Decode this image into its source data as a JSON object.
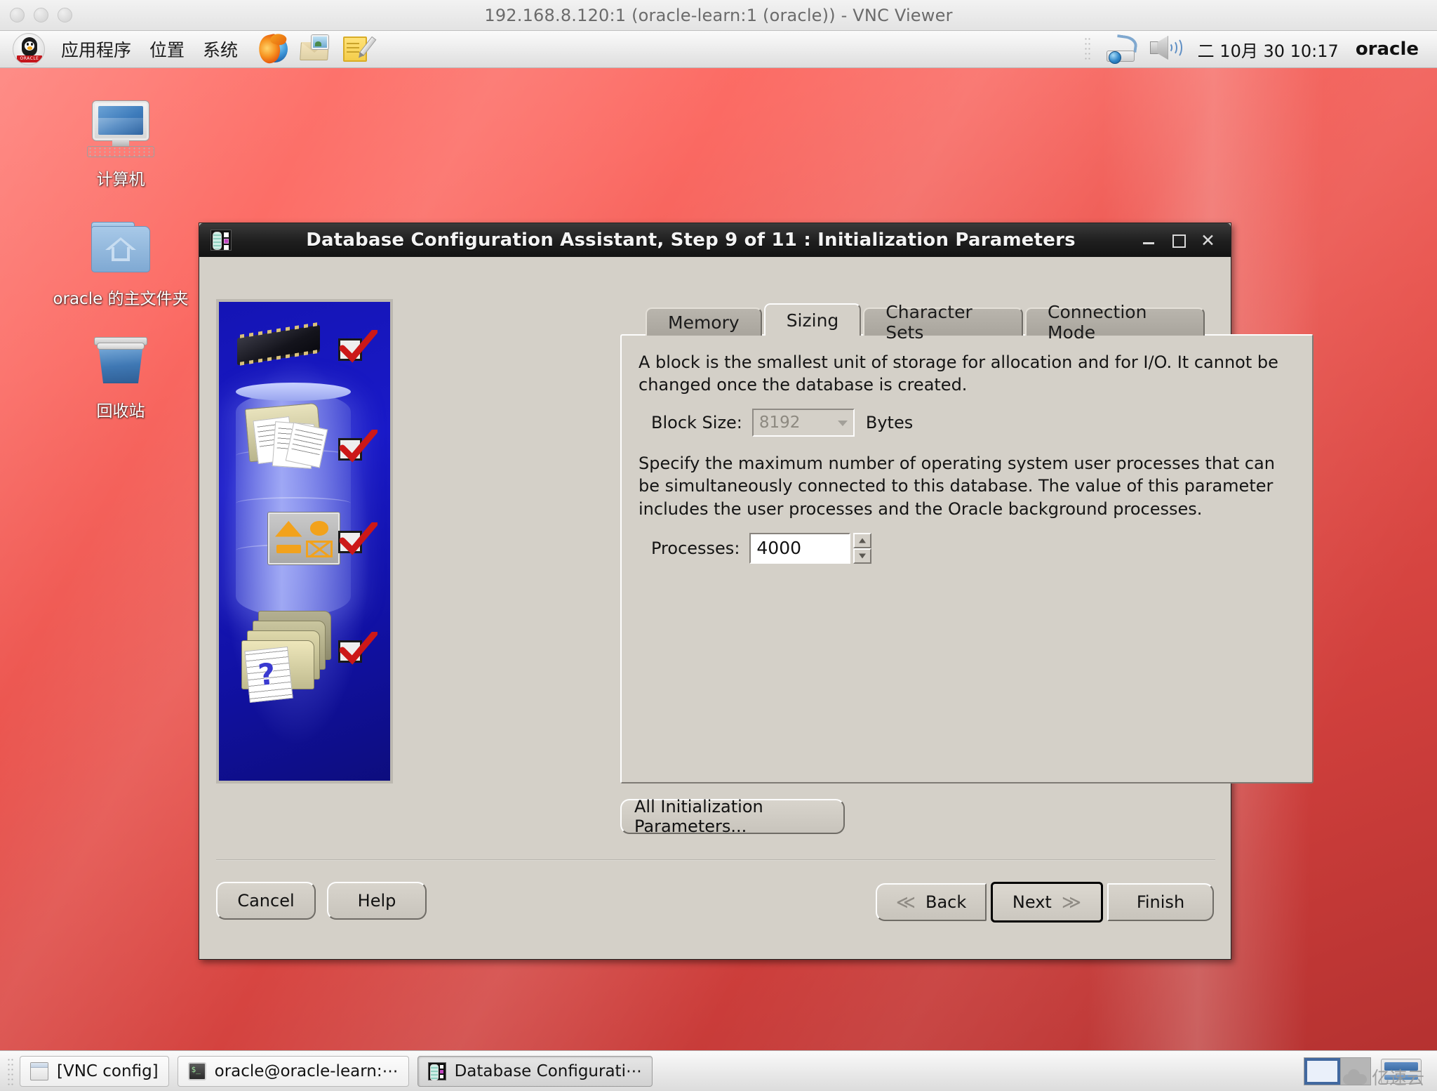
{
  "vnc_window": {
    "title": "192.168.8.120:1 (oracle-learn:1 (oracle)) - VNC Viewer"
  },
  "gnome_panel": {
    "menus": [
      {
        "label": "应用程序",
        "name": "menu-applications"
      },
      {
        "label": "位置",
        "name": "menu-places"
      },
      {
        "label": "系统",
        "name": "menu-system"
      }
    ],
    "launchers": [
      {
        "name": "firefox-icon"
      },
      {
        "name": "email-icon"
      },
      {
        "name": "text-editor-icon"
      }
    ],
    "tray": {
      "network_icon": "network-icon",
      "volume_icon": "volume-icon",
      "clock": "二 10月 30 10:17",
      "user": "oracle"
    }
  },
  "desktop": {
    "icons": [
      {
        "label": "计算机",
        "name": "desktop-icon-computer"
      },
      {
        "label": "oracle 的主文件夹",
        "name": "desktop-icon-home"
      },
      {
        "label": "回收站",
        "name": "desktop-icon-trash"
      }
    ]
  },
  "dialog": {
    "title": "Database Configuration Assistant, Step 9 of 11 : Initialization Parameters",
    "window_buttons": {
      "minimize": "_",
      "maximize": "□",
      "close": "✕"
    },
    "tabs": [
      {
        "label": "Memory",
        "active": false
      },
      {
        "label": "Sizing",
        "active": true
      },
      {
        "label": "Character Sets",
        "active": false
      },
      {
        "label": "Connection Mode",
        "active": false
      }
    ],
    "sizing": {
      "block_description": "A block is the smallest unit of storage for allocation and for I/O. It cannot be changed once the database is created.",
      "block_size_label": "Block Size:",
      "block_size_value": "8192",
      "block_size_unit": "Bytes",
      "processes_description": "Specify the maximum number of operating system user processes that can be simultaneously connected to this database. The value of this parameter includes the user processes and the Oracle background processes.",
      "processes_label": "Processes:",
      "processes_value": "4000"
    },
    "all_params_button": "All Initialization Parameters...",
    "buttons": {
      "cancel": "Cancel",
      "help": "Help",
      "back": "Back",
      "back_mnemonic": "B",
      "next": "Next",
      "next_mnemonic": "N",
      "finish": "Finish",
      "finish_mnemonic": "F"
    }
  },
  "taskbar": {
    "items": [
      {
        "label": "[VNC config]",
        "icon": "window-icon",
        "active": false
      },
      {
        "label": "oracle@oracle-learn:⋯",
        "icon": "terminal-icon",
        "active": false
      },
      {
        "label": "Database Configurati⋯",
        "icon": "dbca-icon",
        "active": true
      }
    ],
    "workspace_switcher": "workspace-switcher",
    "show_desktop": "show-desktop-icon",
    "watermark": "亿速云"
  },
  "colors": {
    "desktop_red": "#e8524c",
    "dialog_face": "#d4d0c8",
    "panel_gray": "#ebebeb",
    "accent_blue": "#41689f"
  }
}
